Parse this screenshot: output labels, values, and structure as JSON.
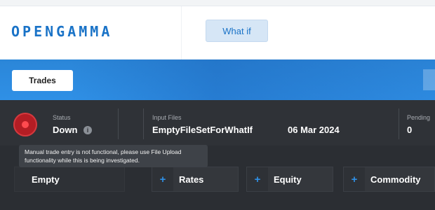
{
  "header": {
    "brand": "OPENGAMMA",
    "whatif_tab": "What if"
  },
  "nav": {
    "trades_button": "Trades"
  },
  "status": {
    "status_label": "Status",
    "status_value": "Down",
    "info_glyph": "i",
    "input_files_label": "Input Files",
    "input_files_value": "EmptyFileSetForWhatIf",
    "date_value": "06 Mar 2024",
    "pending_label": "Pending",
    "pending_value": "0",
    "tooltip": "Manual trade entry is not functional, please use File Upload functionality while this is being investigated.",
    "status_color": "#b41d24"
  },
  "categories": {
    "plus_glyph": "+",
    "empty": "Empty",
    "items": [
      "Rates",
      "Equity",
      "Commodity"
    ]
  },
  "colors": {
    "accent": "#1a73c7",
    "band": "#2f90e6",
    "dark_bg": "#2b2e33"
  }
}
